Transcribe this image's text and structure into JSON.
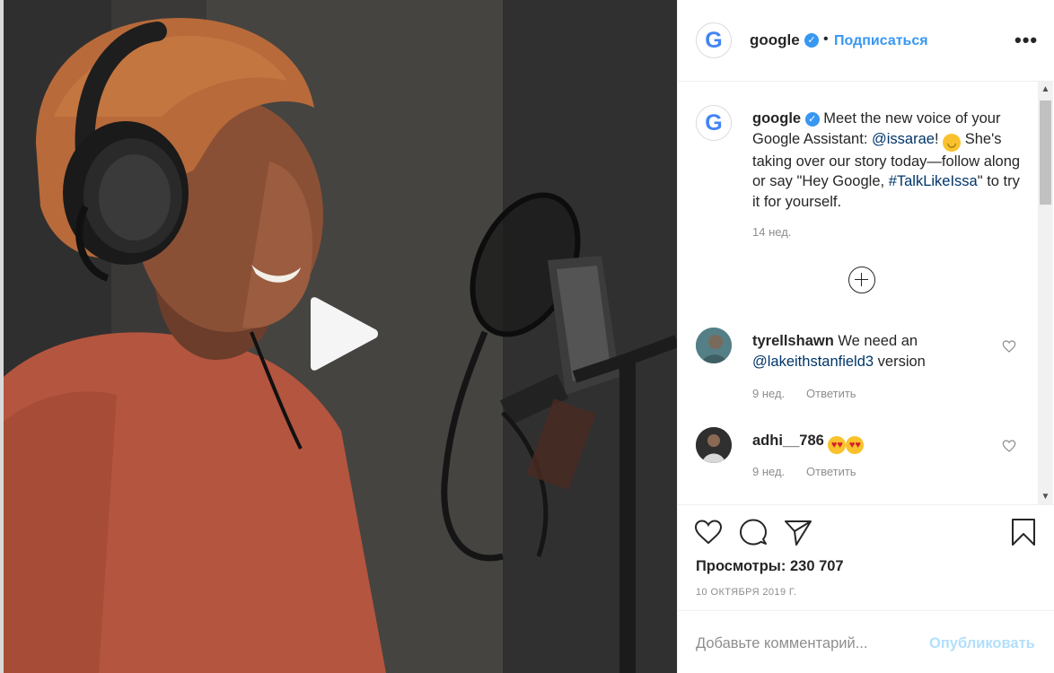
{
  "post": {
    "username": "google",
    "follow_label": "Подписаться",
    "dot": "•",
    "more_label": "•••"
  },
  "caption": {
    "username": "google",
    "text_1": "Meet the new voice of your Google Assistant: ",
    "mention": "@issarae",
    "text_2": "! ",
    "text_3": " She's taking over our story today—follow along or say \"Hey Google, ",
    "hashtag": "#TalkLikeIssa",
    "text_4": "\" to try it for yourself.",
    "time": "14 нед."
  },
  "comments": [
    {
      "username": "tyrellshawn",
      "text_1": " We need an ",
      "mention": "@lakeithstanfield3",
      "text_2": " version",
      "time": "9 нед.",
      "reply_label": "Ответить"
    },
    {
      "username": "adhi__786",
      "time": "9 нед.",
      "reply_label": "Ответить"
    }
  ],
  "stats": {
    "views_label": "Просмотры: 230 707",
    "date": "10 ОКТЯБРЯ 2019 Г."
  },
  "composer": {
    "placeholder": "Добавьте комментарий...",
    "publish_label": "Опубликовать"
  },
  "icons": {
    "play": "play-icon",
    "like": "heart-icon",
    "comment": "speech-bubble-icon",
    "share": "paper-plane-icon",
    "save": "bookmark-icon",
    "verified": "verified-badge-icon",
    "expand": "plus-circle-icon"
  },
  "colors": {
    "link": "#003569",
    "accent": "#3897f0",
    "muted": "#8e8e8e",
    "publish_disabled": "#b2dffc"
  }
}
